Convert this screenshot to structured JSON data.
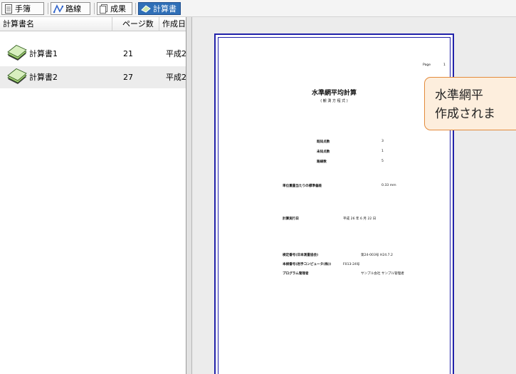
{
  "toolbar": {
    "tabs": [
      {
        "label": "手簿",
        "icon": "notebook-icon"
      },
      {
        "label": "路線",
        "icon": "route-icon"
      },
      {
        "label": "成果",
        "icon": "results-icon"
      },
      {
        "label": "計算書",
        "icon": "calc-doc-icon",
        "active": true
      }
    ]
  },
  "list": {
    "columns": [
      "計算書名",
      "ページ数",
      "作成日"
    ],
    "rows": [
      {
        "name": "計算書1",
        "pages": "21",
        "date": "平成2"
      },
      {
        "name": "計算書2",
        "pages": "27",
        "date": "平成2",
        "selected": true
      }
    ]
  },
  "preview": {
    "page_label": "Page",
    "page_number": "1",
    "doc_title": "水準網平均計算",
    "doc_subtitle": "( 観 測 方 程 式 )",
    "stats": [
      {
        "label": "既知点数",
        "value": "3"
      },
      {
        "label": "未知点数",
        "value": "1"
      },
      {
        "label": "路線数",
        "value": "5"
      }
    ],
    "std_error_label": "単位重量当たりの標準偏差",
    "std_error_value": "0.33 mm",
    "calc_date_label": "計算実行日",
    "calc_date_value": "平成 26 年 6 月 22 日",
    "footer": [
      {
        "label": "検定番号(日本測量協会)",
        "value": "第24-003号  H24.7.2"
      },
      {
        "label": "本検番号(岩手コンピュータ(株))",
        "value": "F013-24号"
      },
      {
        "label": "プログラム管理者",
        "value": "サンプル会社 サンプル管理者"
      }
    ]
  },
  "tooltip": {
    "line1": "水準網平",
    "line2": "作成されま"
  },
  "colors": {
    "active_tab": "#2f6fb7",
    "page_border": "#2222aa",
    "callout_bg": "#fdeedd",
    "callout_border": "#e38b3c"
  }
}
